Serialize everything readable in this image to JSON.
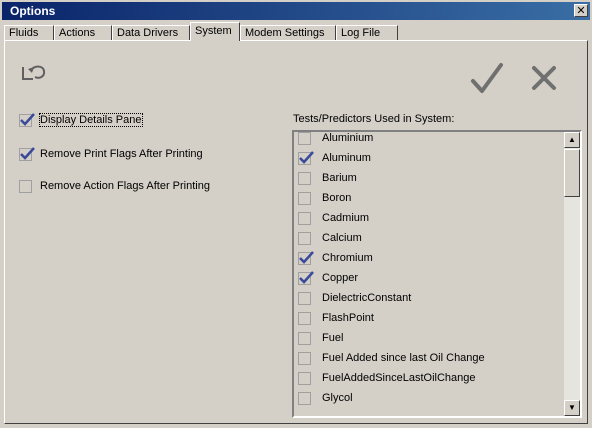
{
  "window": {
    "title": "Options",
    "close_glyph": "✕"
  },
  "tabs": [
    {
      "label": "Fluids"
    },
    {
      "label": "Actions"
    },
    {
      "label": "Data Drivers"
    },
    {
      "label": "System",
      "active": true
    },
    {
      "label": "Modem Settings"
    },
    {
      "label": "Log File"
    }
  ],
  "toolbar": {
    "undo_icon": "undo-icon",
    "ok_icon": "checkmark-icon",
    "cancel_icon": "x-icon"
  },
  "options": [
    {
      "label": "Display Details Pane",
      "checked": true
    },
    {
      "label": "Remove Print Flags After Printing",
      "checked": true
    },
    {
      "label": "Remove Action Flags After Printing",
      "checked": false
    }
  ],
  "tests_list": {
    "label": "Tests/Predictors Used in System:",
    "items": [
      {
        "label": "Aluminium",
        "checked": false
      },
      {
        "label": "Aluminum",
        "checked": true
      },
      {
        "label": "Barium",
        "checked": false
      },
      {
        "label": "Boron",
        "checked": false
      },
      {
        "label": "Cadmium",
        "checked": false
      },
      {
        "label": "Calcium",
        "checked": false
      },
      {
        "label": "Chromium",
        "checked": true
      },
      {
        "label": "Copper",
        "checked": true
      },
      {
        "label": "DielectricConstant",
        "checked": false
      },
      {
        "label": "FlashPoint",
        "checked": false
      },
      {
        "label": "Fuel",
        "checked": false
      },
      {
        "label": "Fuel Added since last Oil Change",
        "checked": false
      },
      {
        "label": "FuelAddedSinceLastOilChange",
        "checked": false
      },
      {
        "label": "Glycol",
        "checked": false
      }
    ]
  },
  "scrollbar": {
    "up_glyph": "▲",
    "down_glyph": "▼"
  }
}
